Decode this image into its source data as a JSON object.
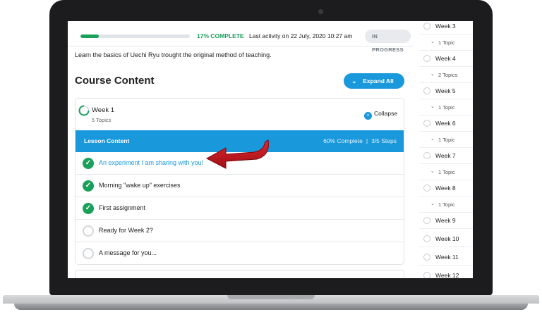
{
  "progress": {
    "fraction": 0.17,
    "percent_label": "17% COMPLETE",
    "last_activity": "Last activity on 22 July, 2020 10:27 am",
    "status": "IN PROGRESS"
  },
  "description": "Learn the basics of Uechi Ryu trought the original method of teaching.",
  "course": {
    "title": "Course Content",
    "expand_label": "Expand All"
  },
  "week1": {
    "title": "Week 1",
    "subtitle": "5 Topics",
    "collapse_label": "Collapse"
  },
  "lesson": {
    "header": "Lesson Content",
    "complete_text": "60% Complete",
    "steps_text": "3/5 Steps",
    "separator": "|",
    "items": [
      {
        "label": "An experiment I am sharing with you!",
        "done": true
      },
      {
        "label": "Morning \"wake up\" exercises",
        "done": true
      },
      {
        "label": "First assignment",
        "done": true
      },
      {
        "label": "Ready for Week 2?",
        "done": false
      },
      {
        "label": "A message for you...",
        "done": false
      }
    ]
  },
  "sidebar": {
    "weeks": [
      {
        "label": "Week 3",
        "topics": "1 Topic"
      },
      {
        "label": "Week 4",
        "topics": "2 Topics"
      },
      {
        "label": "Week 5",
        "topics": "1 Topic"
      },
      {
        "label": "Week 6",
        "topics": "1 Topic"
      },
      {
        "label": "Week 7",
        "topics": "1 Topic"
      },
      {
        "label": "Week 8",
        "topics": "1 Topic"
      },
      {
        "label": "Week 9"
      },
      {
        "label": "Week 10"
      },
      {
        "label": "Week 11"
      },
      {
        "label": "Week 12"
      }
    ]
  },
  "icons": {
    "expand": "chevron-down-icon",
    "collapse": "chevron-up-icon",
    "check": "check-icon",
    "arrow": "red-arrow-icon"
  },
  "colors": {
    "accent": "#1998dc",
    "success": "#19a05b",
    "arrow": "#c4141c"
  }
}
